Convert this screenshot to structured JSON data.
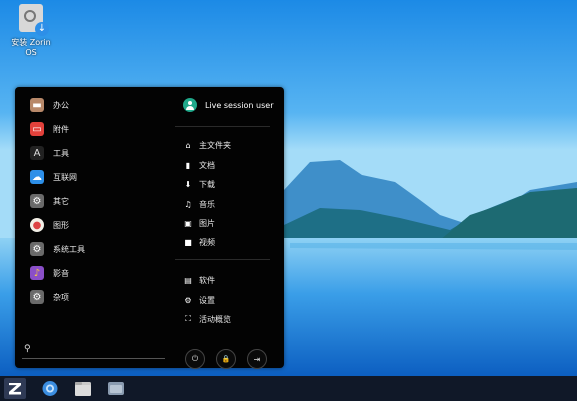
{
  "desktop": {
    "icon_label": "安装 Zorin OS"
  },
  "menu": {
    "categories": [
      {
        "label": "办公",
        "icon": "briefcase-icon",
        "color": "#b8896a"
      },
      {
        "label": "附件",
        "icon": "toolbox-icon",
        "color": "#e2413b"
      },
      {
        "label": "工具",
        "icon": "tools-icon",
        "color": "#3a3a3a"
      },
      {
        "label": "互联网",
        "icon": "cloud-icon",
        "color": "#2d8fe8"
      },
      {
        "label": "其它",
        "icon": "gear-icon",
        "color": "#6a6a6a"
      },
      {
        "label": "图形",
        "icon": "palette-icon",
        "color": "#f2efe6"
      },
      {
        "label": "系统工具",
        "icon": "settings-icon",
        "color": "#6a6a6a"
      },
      {
        "label": "影音",
        "icon": "media-icon",
        "color": "#8a4fc8"
      },
      {
        "label": "杂项",
        "icon": "gear-icon",
        "color": "#6a6a6a"
      }
    ],
    "search": {
      "icon": "search-icon",
      "value": ""
    },
    "user": {
      "name": "Live session user",
      "icon": "user-avatar-icon",
      "color": "#1fa88a"
    },
    "places": [
      {
        "label": "主文件夹",
        "icon": "home-icon",
        "glyph": "⌂"
      },
      {
        "label": "文档",
        "icon": "document-icon",
        "glyph": "▮"
      },
      {
        "label": "下载",
        "icon": "download-icon",
        "glyph": "⬇"
      },
      {
        "label": "音乐",
        "icon": "music-icon",
        "glyph": "♫"
      },
      {
        "label": "图片",
        "icon": "picture-icon",
        "glyph": "▣"
      },
      {
        "label": "视频",
        "icon": "video-icon",
        "glyph": "■"
      }
    ],
    "system": [
      {
        "label": "软件",
        "icon": "software-icon",
        "glyph": "▤"
      },
      {
        "label": "设置",
        "icon": "settings-icon",
        "glyph": "⚙"
      },
      {
        "label": "活动概览",
        "icon": "overview-icon",
        "glyph": "⛶"
      }
    ],
    "power_buttons": [
      {
        "icon": "power-icon",
        "glyph": "⏻"
      },
      {
        "icon": "lock-icon",
        "glyph": "🔒"
      },
      {
        "icon": "logout-icon",
        "glyph": "⇥"
      }
    ]
  },
  "taskbar": {
    "apps": [
      {
        "icon": "browser-icon",
        "color": "#3b8de0"
      },
      {
        "icon": "files-icon",
        "color": "#d0d0d0"
      },
      {
        "icon": "software-store-icon",
        "color": "#8a9bb0"
      }
    ]
  }
}
